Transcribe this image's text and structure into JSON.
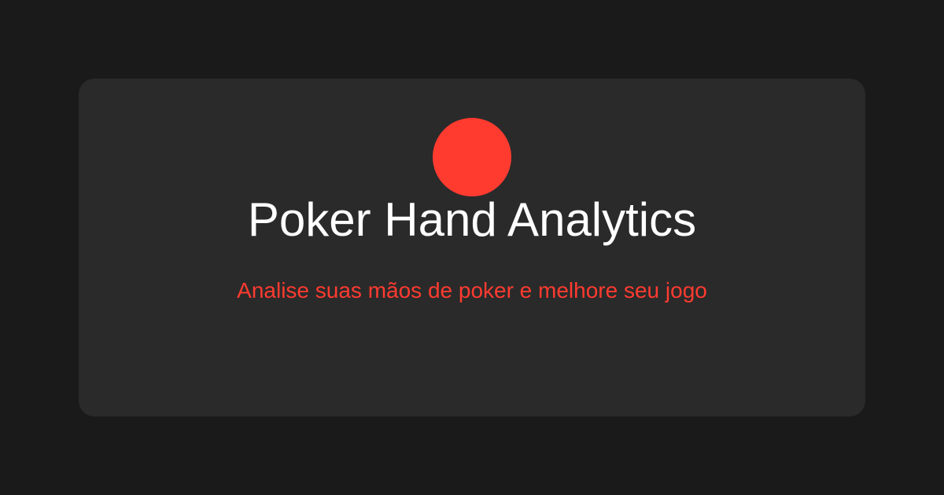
{
  "colors": {
    "page_background": "#1a1a1a",
    "card_background": "#2a2a2a",
    "accent": "#ff3b30",
    "title_text": "#ffffff"
  },
  "logo": {
    "icon": "red-circle-icon"
  },
  "header": {
    "title": "Poker Hand Analytics",
    "subtitle": "Analise suas mãos de poker e melhore seu jogo"
  }
}
